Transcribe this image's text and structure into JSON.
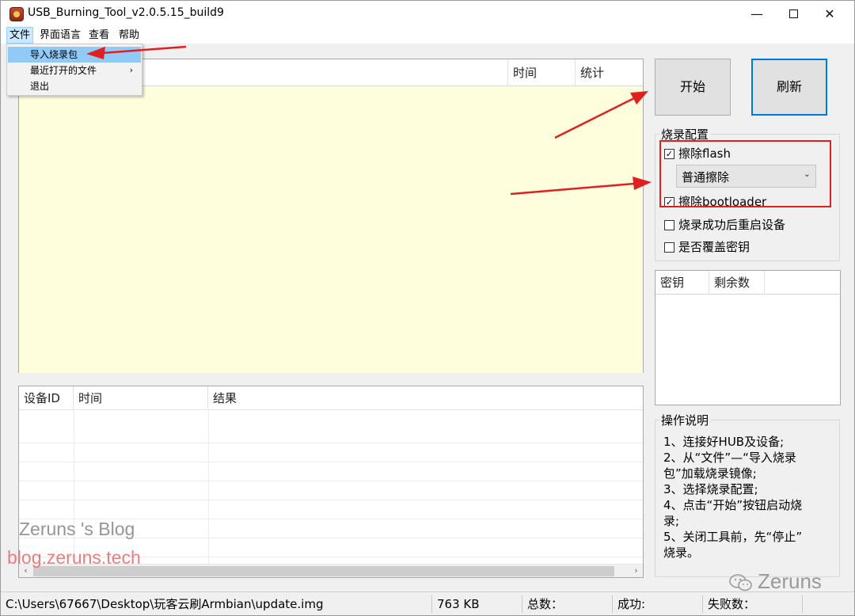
{
  "window": {
    "title": "USB_Burning_Tool_v2.0.5.15_build9",
    "minimize_glyph": "—",
    "close_glyph": "✕"
  },
  "menubar": {
    "items": [
      "文件",
      "界面语言",
      "查看",
      "帮助"
    ]
  },
  "file_menu": {
    "items": [
      {
        "label": "导入烧录包",
        "highlighted": true
      },
      {
        "label": "最近打开的文件",
        "submenu_glyph": "›"
      },
      {
        "label": "退出"
      }
    ]
  },
  "device_grid": {
    "columns": [
      "时间",
      "统计"
    ]
  },
  "buttons": {
    "start": "开始",
    "refresh": "刷新"
  },
  "burn_config": {
    "title": "烧录配置",
    "erase_flash": {
      "label": "擦除flash",
      "checked": true,
      "check_glyph": "✓"
    },
    "erase_mode": {
      "value": "普通擦除",
      "arrow_glyph": "⌄"
    },
    "erase_bootloader": {
      "label": "擦除bootloader",
      "checked": true,
      "check_glyph": "✓"
    },
    "reboot_after": {
      "label": "烧录成功后重启设备",
      "checked": false
    },
    "overwrite_key": {
      "label": "是否覆盖密钥",
      "checked": false
    }
  },
  "key_list": {
    "columns": [
      "密钥",
      "剩余数"
    ]
  },
  "instructions": {
    "title": "操作说明",
    "lines": [
      "1、连接好HUB及设备;",
      "2、从“文件”—“导入烧录",
      "包”加载烧录镜像;",
      "3、选择烧录配置;",
      "4、点击“开始”按钮启动烧",
      "录;",
      "5、关闭工具前，先“停止”",
      "烧录。"
    ]
  },
  "log": {
    "columns": [
      "设备ID",
      "时间",
      "结果"
    ],
    "scroll_left_glyph": "‹",
    "scroll_right_glyph": "›"
  },
  "statusbar": {
    "path": "C:\\Users\\67667\\Desktop\\玩客云刷Armbian\\update.img",
    "size": "763 KB",
    "total": "总数：",
    "success": "成功:",
    "failed": "失败数："
  },
  "watermarks": {
    "blog_name": "Zeruns 's Blog",
    "blog_url": "blog.zeruns.tech",
    "wechat_name": "Zeruns",
    "wechat_icon": "wechat-icon"
  },
  "colors": {
    "accent": "#0078d7",
    "highlight_box": "#e02020",
    "arrow": "#e02020",
    "log_area": "#fffedc",
    "menu_highlight": "#91c9f7"
  }
}
